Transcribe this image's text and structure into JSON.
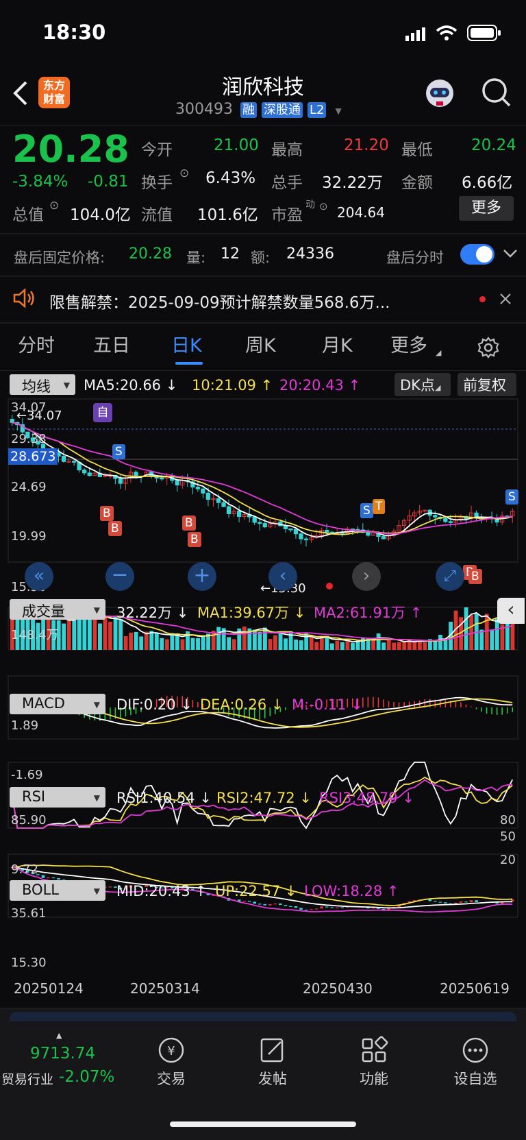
{
  "status_bar": {
    "time": "18:30"
  },
  "header": {
    "logo_top": "东方",
    "logo_bottom": "财富",
    "title": "润欣科技",
    "code": "300493",
    "badges": [
      "融",
      "深股通",
      "L2"
    ]
  },
  "quote": {
    "price": "20.28",
    "pct": "-3.84%",
    "change": "-0.81",
    "open_label": "今开",
    "open": "21.00",
    "high_label": "最高",
    "high": "21.20",
    "low_label": "最低",
    "low": "20.24",
    "turnover_label": "换手",
    "turnover": "6.43%",
    "volume_label": "总手",
    "volume": "32.22万",
    "amount_label": "金额",
    "amount": "6.66亿",
    "mcap_label": "总值",
    "mcap": "104.0亿",
    "float_label": "流值",
    "float": "101.6亿",
    "pe_label": "市盈",
    "pe_sup": "动",
    "pe": "204.64",
    "more": "更多"
  },
  "after_hours": {
    "label": "盘后固定价格:",
    "price": "20.28",
    "vol_label": "量:",
    "vol": "12",
    "amt_label": "额:",
    "amt": "24336",
    "toggle_label": "盘后分时"
  },
  "notice": {
    "text": "限售解禁：2025-09-09预计解禁数量568.6万..."
  },
  "tabs": [
    "分时",
    "五日",
    "日K",
    "周K",
    "月K",
    "更多"
  ],
  "kline": {
    "selector": "均线",
    "ma5": "MA5:20.66 ↓",
    "ma10": "10:21.09 ↑",
    "ma20": "20:20.43 ↑",
    "dk_button": "DK点",
    "adjust_button": "前复权",
    "y_ticks": [
      "34.07",
      "29.38",
      "24.69",
      "19.99",
      "15.30"
    ],
    "crosshair_price": "28.673",
    "max_label": "←34.07",
    "min_label": "←15.30",
    "marker_zi": "自",
    "b": "B",
    "s": "S",
    "t": "T"
  },
  "volume": {
    "selector": "成交量",
    "v": "32.22万 ↓",
    "ma1": "MA1:39.67万 ↓",
    "ma2": "MA2:61.91万 ↑",
    "max": "148.4万"
  },
  "macd": {
    "selector": "MACD",
    "dif": "DIF:0.20 ↓",
    "dea": "DEA:0.26 ↓",
    "m": "M:-0.11 ↓",
    "top": "1.89",
    "bottom": "-1.69"
  },
  "rsi": {
    "selector": "RSI",
    "r1": "RSI1:40.54 ↓",
    "r2": "RSI2:47.72 ↓",
    "r3": "RSI3:48.79 ↓",
    "top": "85.90",
    "bottom": "9.72",
    "r80": "80",
    "r50": "50",
    "r20": "20"
  },
  "boll": {
    "selector": "BOLL",
    "mid": "MID:20.43 ↑",
    "up": "UP:22.57 ↓",
    "low": "LOW:18.28 ↑",
    "top": "35.61",
    "bottom": "15.30"
  },
  "dates": [
    "20250124",
    "20250314",
    "20250430",
    "20250619"
  ],
  "bottom_nav": {
    "index_value": "9713.74",
    "index_name": "贸易行业",
    "index_pct": "-2.07%",
    "items": [
      "交易",
      "发帖",
      "功能",
      "设自选"
    ]
  }
}
